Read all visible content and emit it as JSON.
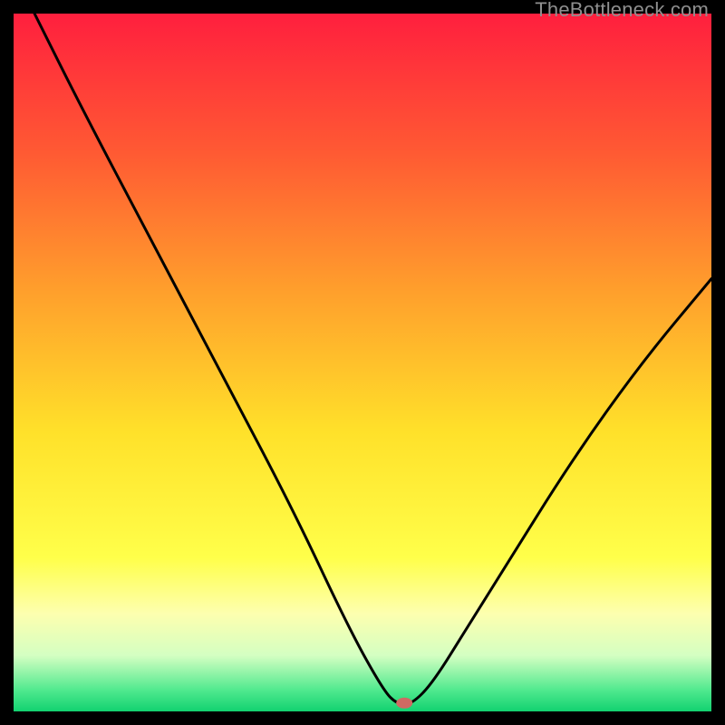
{
  "watermark": "TheBottleneck.com",
  "chart_data": {
    "type": "line",
    "title": "",
    "xlabel": "",
    "ylabel": "",
    "xlim": [
      0,
      100
    ],
    "ylim": [
      0,
      100
    ],
    "series": [
      {
        "name": "bottleneck-curve",
        "x": [
          3,
          10,
          20,
          30,
          40,
          48,
          53,
          55,
          57,
          60,
          65,
          70,
          80,
          90,
          100
        ],
        "y": [
          100,
          86,
          67,
          48,
          29,
          12,
          3,
          1,
          1,
          4,
          12,
          20,
          36,
          50,
          62
        ]
      }
    ],
    "marker": {
      "x": 56,
      "y": 1.2
    },
    "gradient_stops": [
      {
        "offset": 0.0,
        "color": "#ff1f3e"
      },
      {
        "offset": 0.2,
        "color": "#ff5a33"
      },
      {
        "offset": 0.4,
        "color": "#ffa02c"
      },
      {
        "offset": 0.6,
        "color": "#ffe12a"
      },
      {
        "offset": 0.78,
        "color": "#ffff4a"
      },
      {
        "offset": 0.86,
        "color": "#fdffaf"
      },
      {
        "offset": 0.92,
        "color": "#d4ffc2"
      },
      {
        "offset": 0.97,
        "color": "#4fe98e"
      },
      {
        "offset": 1.0,
        "color": "#12d270"
      }
    ]
  }
}
